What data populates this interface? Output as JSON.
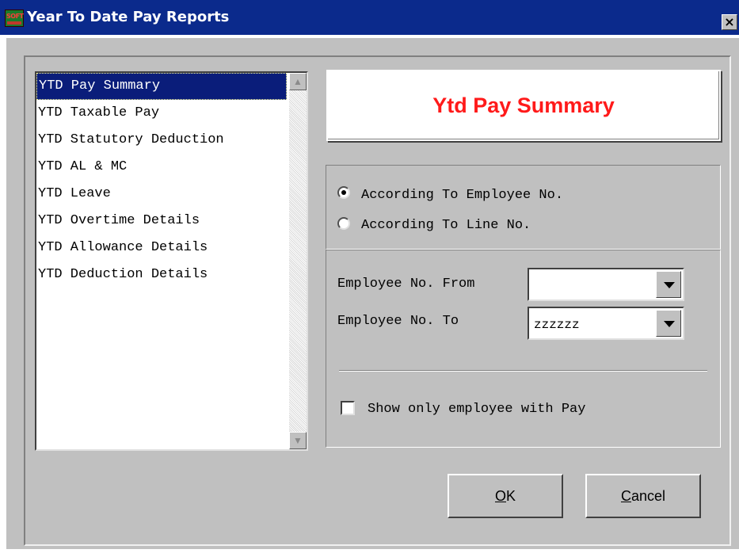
{
  "window": {
    "title": "Year To Date Pay Reports",
    "icon_text": "SOFT",
    "close_glyph": "×"
  },
  "report_list": {
    "items": [
      "YTD Pay Summary",
      "YTD Taxable Pay",
      "YTD Statutory Deduction",
      "YTD AL & MC",
      "YTD Leave",
      "YTD Overtime Details",
      "YTD Allowance Details",
      "YTD Deduction Details"
    ],
    "selected_index": 0,
    "scroll_up_glyph": "▲",
    "scroll_down_glyph": "▼"
  },
  "banner": {
    "text": "Ytd Pay Summary",
    "color": "#ff1a1a"
  },
  "sort_options": [
    {
      "label": "According To Employee No.",
      "selected": true
    },
    {
      "label": "According To Line No.",
      "selected": false
    }
  ],
  "filters": {
    "from_label": "Employee No. From",
    "from_value": "",
    "to_label": "Employee No. To",
    "to_value": "zzzzzz"
  },
  "show_only_with_pay": {
    "label": "Show only employee with Pay",
    "checked": false
  },
  "buttons": {
    "ok": {
      "mnemonic": "O",
      "rest": "K"
    },
    "cancel": {
      "mnemonic": "C",
      "rest": "ancel"
    }
  },
  "colors": {
    "title_bar": "#0b2a8c",
    "dialog_face": "#c0c0c0",
    "selection": "#0a1d7a"
  }
}
